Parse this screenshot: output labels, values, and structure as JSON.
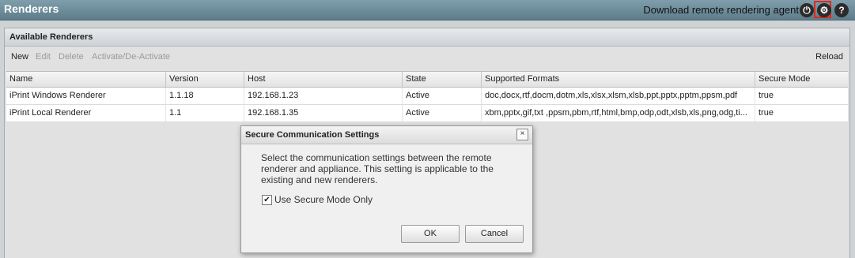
{
  "header": {
    "title": "Renderers",
    "download_link": "Download remote rendering agent",
    "icons": [
      "power-icon",
      "gear-icon",
      "help-icon"
    ]
  },
  "panel": {
    "title": "Available Renderers",
    "toolbar": {
      "new": "New",
      "edit": "Edit",
      "delete": "Delete",
      "activate": "Activate/De-Activate",
      "reload": "Reload"
    },
    "columns": [
      "Name",
      "Version",
      "Host",
      "State",
      "Supported Formats",
      "Secure Mode"
    ],
    "rows": [
      [
        "iPrint Windows Renderer",
        "1.1.18",
        "192.168.1.23",
        "Active",
        "doc,docx,rtf,docm,dotm,xls,xlsx,xlsm,xlsb,ppt,pptx,pptm,ppsm,pdf",
        "true"
      ],
      [
        "iPrint Local Renderer",
        "1.1",
        "192.168.1.35",
        "Active",
        "xbm,pptx,gif,txt ,ppsm,pbm,rtf,html,bmp,odp,odt,xlsb,xls,png,odg,ti...",
        "true"
      ]
    ]
  },
  "dialog": {
    "title": "Secure Communication Settings",
    "close": "×",
    "message": "Select the communication settings between the remote renderer and appliance. This setting is applicable to the existing and new renderers.",
    "checkbox_label": "Use Secure Mode Only",
    "checkbox_checked": true,
    "ok": "OK",
    "cancel": "Cancel"
  },
  "colors": {
    "topbar": "#6a8896",
    "highlight": "#e0281e"
  }
}
